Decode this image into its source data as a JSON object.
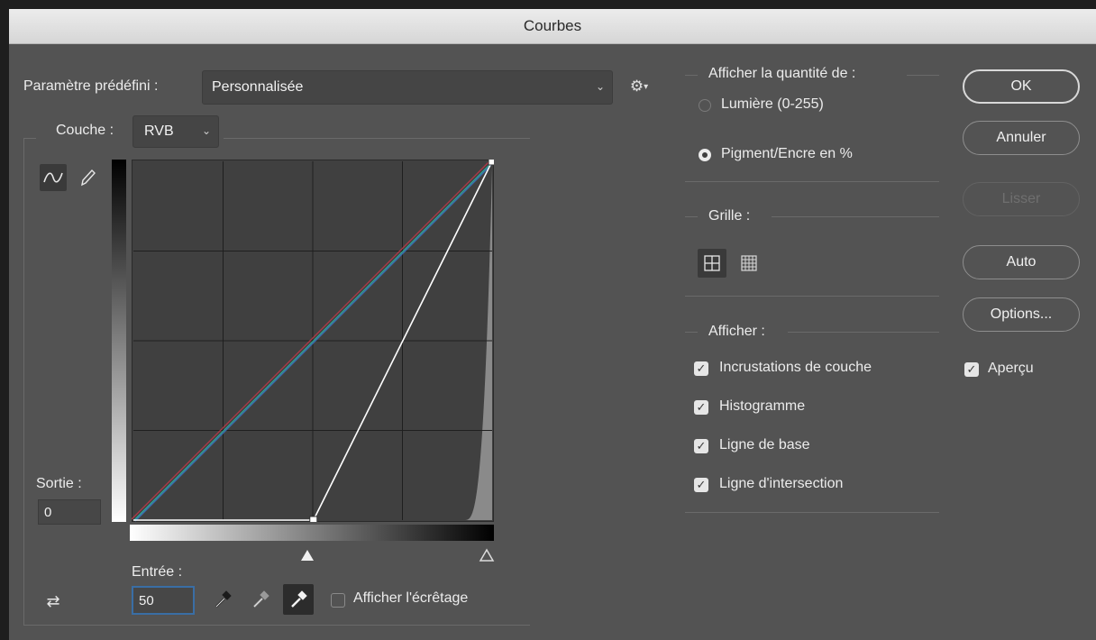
{
  "window": {
    "title": "Courbes"
  },
  "preset": {
    "label": "Paramètre prédéfini :",
    "value": "Personnalisée"
  },
  "channel": {
    "label": "Couche :",
    "value": "RVB"
  },
  "output": {
    "label": "Sortie :",
    "value": "0"
  },
  "input": {
    "label": "Entrée :",
    "value": "50"
  },
  "clipping": {
    "label": "Afficher l'écrêtage",
    "checked": false
  },
  "display_amount": {
    "title": "Afficher la quantité de :",
    "options": [
      {
        "label": "Lumière (0-255)",
        "selected": false
      },
      {
        "label": "Pigment/Encre en %",
        "selected": true
      }
    ]
  },
  "grid": {
    "title": "Grille :",
    "options": [
      "simple-grid-icon",
      "detailed-grid-icon"
    ],
    "selected": "simple-grid-icon"
  },
  "show": {
    "title": "Afficher :",
    "items": [
      {
        "label": "Incrustations de couche",
        "checked": true
      },
      {
        "label": "Histogramme",
        "checked": true
      },
      {
        "label": "Ligne de base",
        "checked": true
      },
      {
        "label": "Ligne d'intersection",
        "checked": true
      }
    ]
  },
  "buttons": {
    "ok": "OK",
    "cancel": "Annuler",
    "smooth": "Lisser",
    "auto": "Auto",
    "options": "Options..."
  },
  "preview": {
    "label": "Aperçu",
    "checked": true
  },
  "colors": {
    "red_curve": "#b03a48",
    "green_curve": "#2fa89a",
    "blue_curve": "#3b6fb5",
    "white_curve": "#ffffff",
    "focus": "#3a6ea5"
  },
  "chart_data": {
    "type": "line",
    "xlim": [
      0,
      255
    ],
    "ylim": [
      0,
      255
    ],
    "grid": true,
    "series": [
      {
        "points": [
          [
            0,
            0
          ],
          [
            255,
            255
          ]
        ]
      },
      {
        "points": [
          [
            0,
            0
          ],
          [
            255,
            255
          ]
        ]
      },
      {
        "points": [
          [
            0,
            0
          ],
          [
            255,
            255
          ]
        ]
      },
      {
        "points": [
          [
            0,
            0
          ],
          [
            128,
            0
          ],
          [
            255,
            255
          ]
        ]
      }
    ]
  }
}
